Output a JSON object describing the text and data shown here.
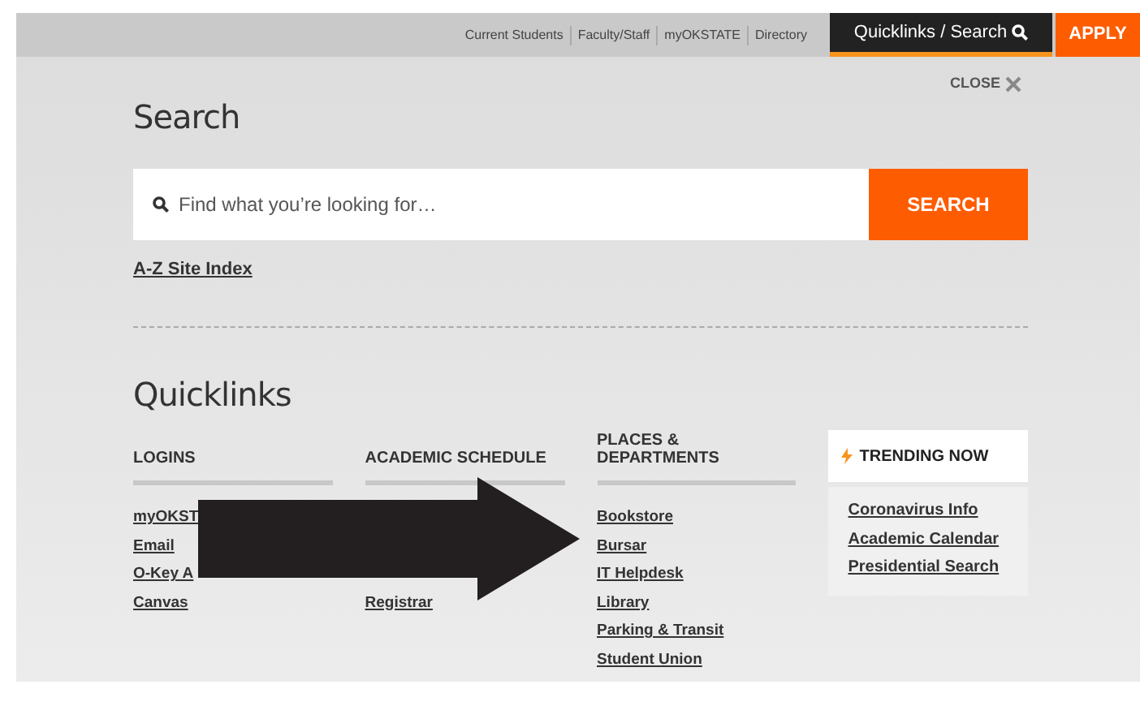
{
  "top_links": [
    "Current Students",
    "Faculty/Staff",
    "myOKSTATE",
    "Directory"
  ],
  "quicklinks_tab": {
    "label": "Quicklinks / Search",
    "selected": true
  },
  "apply_button": "APPLY",
  "close": "CLOSE",
  "search": {
    "heading": "Search",
    "placeholder": "Find what you’re looking for…",
    "button": "SEARCH",
    "index_link": "A-Z Site Index"
  },
  "quicklinks": {
    "heading": "Quicklinks",
    "columns": [
      {
        "title": "LOGINS",
        "links": [
          "myOKST",
          "Email",
          "O-Key A",
          "Canvas"
        ]
      },
      {
        "title": "ACADEMIC SCHEDULE",
        "links": [
          "Registrar"
        ]
      },
      {
        "title": "PLACES & DEPARTMENTS",
        "links": [
          "Bookstore",
          "Bursar",
          "IT Helpdesk",
          "Library",
          "Parking & Transit",
          "Student Union"
        ]
      }
    ],
    "trending": {
      "title": "TRENDING NOW",
      "links": [
        "Coronavirus Info",
        "Academic Calendar",
        "Presidential Search"
      ]
    }
  }
}
